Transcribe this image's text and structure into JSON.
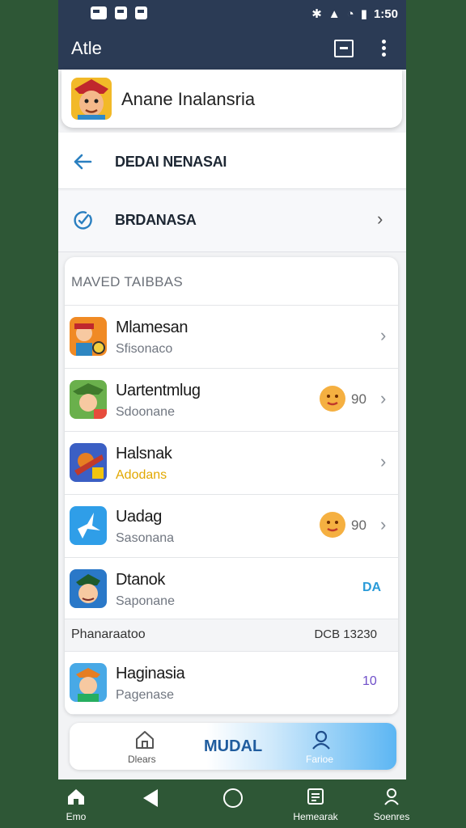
{
  "status_bar": {
    "left_icons": [
      "sim-icon",
      "alarm-icon",
      "notification-icon"
    ],
    "time": "1:50"
  },
  "app_bar": {
    "title": "Atle"
  },
  "profile": {
    "name": "Anane Inalansria"
  },
  "menu": [
    {
      "icon": "back-arrow-icon",
      "label": "DEDAI NENASAI"
    },
    {
      "icon": "check-circle-icon",
      "label": "BRDANASA"
    }
  ],
  "card": {
    "header": "MAVED TAIBBAS",
    "items": [
      {
        "title": "Mlamesan",
        "subtitle": "Sfisonaco",
        "subtitle_color": "gray",
        "extra": ""
      },
      {
        "title": "Uartentmlug",
        "subtitle": "Sdoonane",
        "extra": "90"
      },
      {
        "title": "Halsnak",
        "subtitle": "Adodans",
        "subtitle_color": "#e2a800",
        "extra": ""
      },
      {
        "title": "Uadag",
        "subtitle": "Sasonana",
        "extra": "90"
      },
      {
        "title": "Dtanok",
        "subtitle": "Saponane",
        "tag": "DA"
      }
    ],
    "section": {
      "left": "Phanaraatoo",
      "right": "DCB 13230"
    },
    "last_item": {
      "title": "Haginasia",
      "subtitle": "Pagenase",
      "tag": "10"
    }
  },
  "dock": {
    "home_label": "Dlears",
    "center_label": "MUDAL",
    "user_label": "Farioe"
  },
  "nav": {
    "home": "Emo",
    "recents": "Hemearak",
    "search": "Soenres"
  },
  "colors": {
    "app_bar": "#2b3b55",
    "accent": "#2a9bd8",
    "background": "#2e5736"
  }
}
